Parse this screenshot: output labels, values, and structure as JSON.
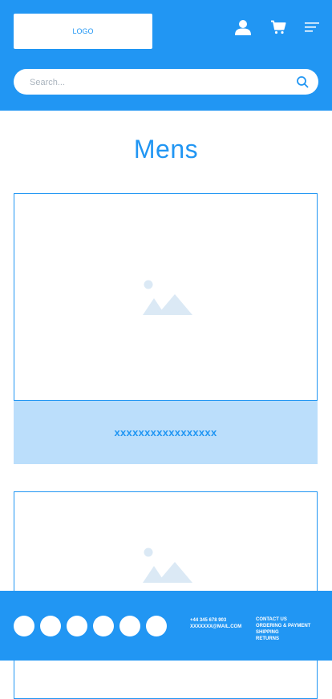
{
  "header": {
    "logo_text": "LOGO",
    "icons": [
      "user-icon",
      "cart-icon",
      "menu-icon"
    ]
  },
  "search": {
    "placeholder": "Search..."
  },
  "page": {
    "title": "Mens"
  },
  "products": [
    {
      "caption": "xxxxxxxxxxxxxxxxx",
      "image_icon": "image-placeholder-icon"
    },
    {
      "caption": "",
      "image_icon": "image-placeholder-icon"
    }
  ],
  "footer": {
    "social_icons": [
      "social-icon-1",
      "social-icon-2",
      "social-icon-3",
      "social-icon-4",
      "social-icon-5",
      "social-icon-6"
    ],
    "phone": "+44 345 678 903",
    "email": "XXXXXXX@MAIL.COM",
    "links": [
      "CONTACT US",
      "ORDERING & PAYMENT",
      "SHIPPING",
      "RETURNS"
    ]
  },
  "colors": {
    "primary": "#2196f3",
    "light": "#bbdefb",
    "placeholder_icon": "#dbe9f5"
  }
}
